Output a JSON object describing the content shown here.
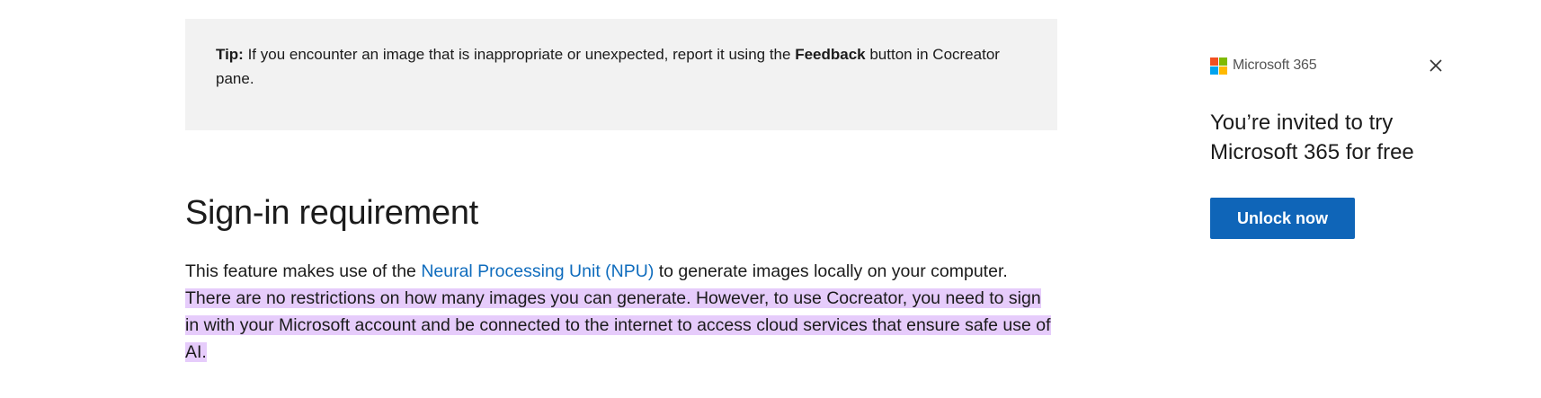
{
  "tip": {
    "lead": "Tip:",
    "text_before": " If you encounter an image that is inappropriate or unexpected, report it using the ",
    "strong": "Feedback",
    "text_after": " button in Cocreator pane."
  },
  "section": {
    "heading": "Sign-in requirement",
    "body_start": "This feature makes use of the ",
    "link_text": "Neural Processing Unit (NPU)",
    "body_mid": " to generate images locally on your computer.",
    "highlighted": "There are no restrictions on how many images you can generate. However, to use Cocreator, you need to sign in with your Microsoft account and be connected to the internet to access cloud services that ensure safe use of AI."
  },
  "promo": {
    "brand": "Microsoft 365",
    "headline": "You’re invited to try Microsoft 365 for free",
    "button_label": "Unlock now",
    "logo_colors": [
      "#f25022",
      "#7fba00",
      "#00a4ef",
      "#ffb900"
    ],
    "close_icon": "close-icon"
  },
  "colors": {
    "link": "#0f6cbd",
    "highlight": "#e6ccfb",
    "tip_background": "#f2f2f2",
    "button": "#0f65b8"
  }
}
